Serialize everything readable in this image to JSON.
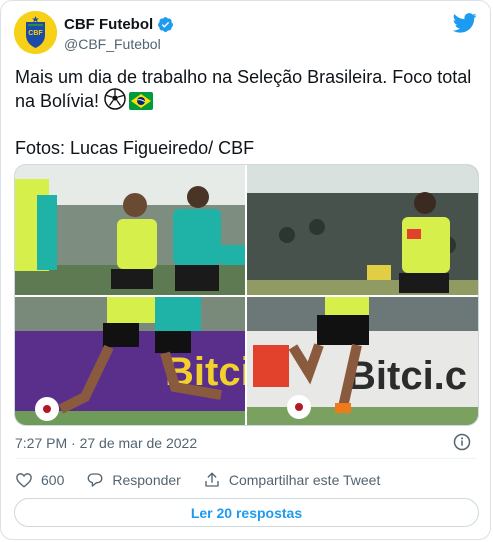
{
  "author": {
    "display_name": "CBF Futebol",
    "handle": "@CBF_Futebol",
    "verified": true,
    "avatar_text": "CBF"
  },
  "tweet": {
    "text": "Mais um dia de trabalho na Seleção Brasileira. Foco total na Bolívia! ",
    "credits": "Fotos: Lucas Figueiredo/ CBF",
    "emojis": [
      "soccer-ball-icon",
      "brazil-flag-icon"
    ]
  },
  "media": {
    "photo_count": 4,
    "signage_p4": "Bitci.c",
    "signage_p3": "Bitci"
  },
  "meta": {
    "timestamp": "7:27 PM · 27 de mar de 2022"
  },
  "actions": {
    "like_count": "600",
    "reply_label": "Responder",
    "share_label": "Compartilhar este Tweet"
  },
  "footer": {
    "read_replies_label": "Ler 20 respostas"
  },
  "colors": {
    "accent": "#1d9bf0",
    "muted": "#536471",
    "jersey_yellow": "#d6ef4a",
    "jersey_teal": "#1fb3a7",
    "pitch_green": "#6f9b5a"
  }
}
